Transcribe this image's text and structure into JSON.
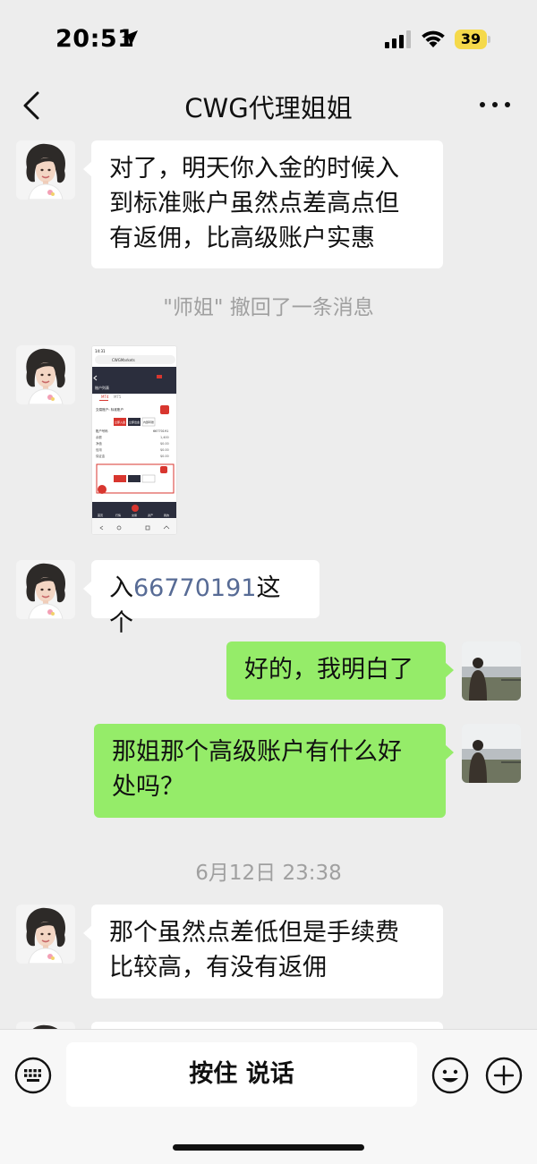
{
  "status_bar": {
    "time": "20:51",
    "battery": "39"
  },
  "nav": {
    "title": "CWG代理姐姐"
  },
  "messages": [
    {
      "text": "对了，明天你入金的时候入\n到标准账户虽然点差高点但\n有返佣，比高级账户实惠"
    },
    {
      "system": "\"师姐\" 撤回了一条消息"
    },
    {
      "image": {
        "status_time": "14:31",
        "url": "CWGMarkets",
        "page_title": "账户列表",
        "tabs": [
          "MT4",
          "MT5"
        ],
        "account_label": "交易账户: 标准账户",
        "account_number": "66770191",
        "rows": [
          {
            "label": "余额",
            "value": "1,400"
          },
          {
            "label": "净值",
            "value": "$0.00"
          },
          {
            "label": "信用",
            "value": "$0.00"
          },
          {
            "label": "保证金",
            "value": "$0.00"
          }
        ],
        "buttons": [
          "立即入金",
          "立即出金",
          "内部转账"
        ],
        "tab_bar": [
          "首页",
          "行情",
          "交易",
          "资产",
          "我的"
        ]
      }
    },
    {
      "text_prefix": "入",
      "text_number": "66770191",
      "text_suffix": "这个"
    },
    {
      "text": "好的，我明白了"
    },
    {
      "text": "那姐那个高级账户有什么好\n处吗？"
    },
    {
      "system": "6月12日 23:38"
    },
    {
      "text": "那个虽然点差低但是手续费\n比较高，有没有返佣"
    }
  ],
  "input_bar": {
    "voice_label": "按住 说话"
  },
  "colors": {
    "background": "#ededed",
    "self_bubble": "#95ec69",
    "link": "#576b95"
  }
}
